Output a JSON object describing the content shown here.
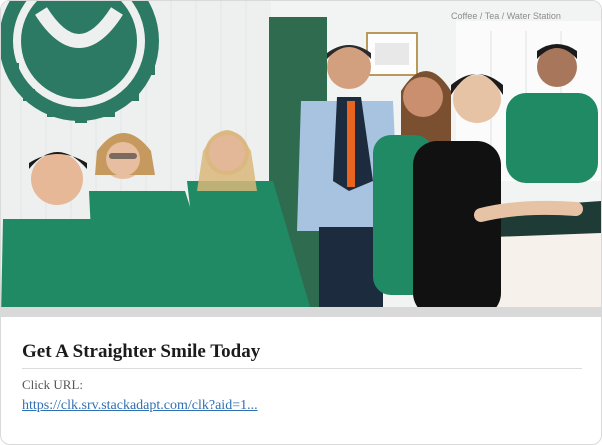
{
  "ad": {
    "image_alt": "Smiling dental practice team in green scrubs standing in the clinic reception",
    "wall_sign": "Coffee / Tea / Water Station",
    "headline": "Get A Straighter Smile Today",
    "click_label": "Click URL:",
    "click_url": "https://clk.srv.stackadapt.com/clk?aid=1..."
  },
  "colors": {
    "scrub_green": "#1f8a64",
    "logo_green": "#2c7a64",
    "link_blue": "#2f6fb3",
    "suit_blue": "#a8c3e0",
    "tie_orange": "#e8651f"
  }
}
